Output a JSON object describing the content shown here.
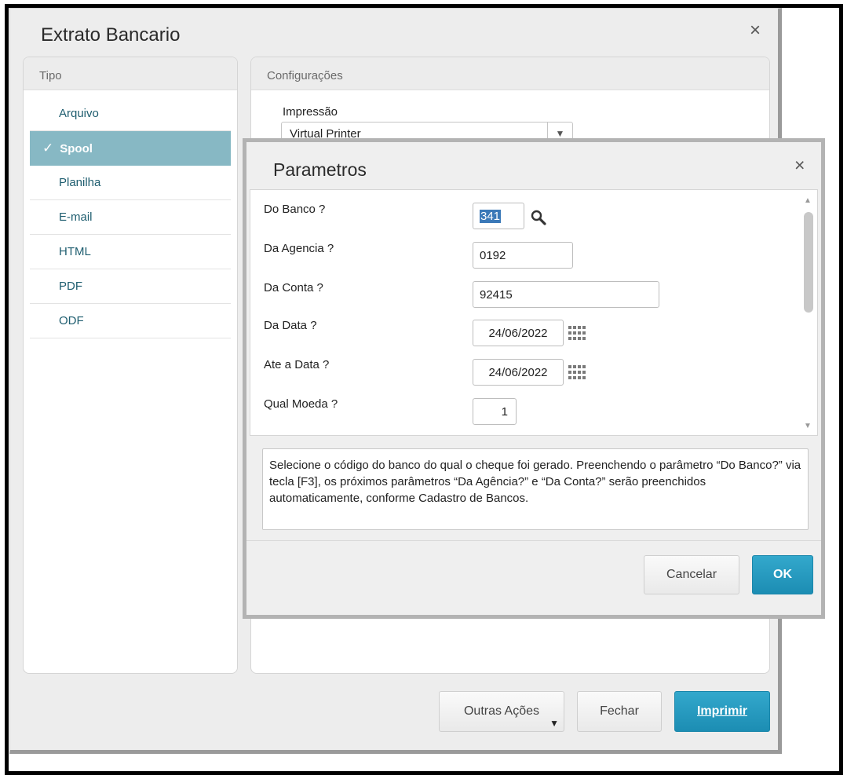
{
  "main_dialog": {
    "title": "Extrato Bancario",
    "close_label": "×",
    "tipo": {
      "header": "Tipo",
      "selected_check": "✓",
      "items": [
        {
          "label": "Arquivo"
        },
        {
          "label": "Spool"
        },
        {
          "label": "Planilha"
        },
        {
          "label": "E-mail"
        },
        {
          "label": "HTML"
        },
        {
          "label": "PDF"
        },
        {
          "label": "ODF"
        }
      ]
    },
    "configuracoes": {
      "header": "Configurações",
      "impressao_label": "Impressão",
      "impressao_value": "Virtual Printer"
    },
    "footer": {
      "outras_acoes": "Outras Ações",
      "fechar": "Fechar",
      "imprimir": "Imprimir"
    }
  },
  "parametros_dialog": {
    "title": "Parametros",
    "close_label": "×",
    "fields": {
      "do_banco": {
        "label": "Do Banco ?",
        "value": "341"
      },
      "da_agencia": {
        "label": "Da Agencia ?",
        "value": "0192"
      },
      "da_conta": {
        "label": "Da Conta ?",
        "value": "92415"
      },
      "da_data": {
        "label": "Da Data ?",
        "value": "24/06/2022"
      },
      "ate_a_data": {
        "label": "Ate a Data ?",
        "value": "24/06/2022"
      },
      "qual_moeda": {
        "label": "Qual Moeda ?",
        "value": "1"
      }
    },
    "help_text": "Selecione o código do banco do qual o cheque foi gerado. Preenchendo o parâmetro “Do Banco?” via tecla [F3], os próximos parâmetros “Da Agência?” e “Da Conta?” serão preenchidos automaticamente, conforme Cadastro de Bancos.",
    "cancelar": "Cancelar",
    "ok": "OK"
  },
  "colors": {
    "accent": "#2199c0",
    "selected_item": "#87b8c4",
    "link_text": "#1e5d6f"
  }
}
